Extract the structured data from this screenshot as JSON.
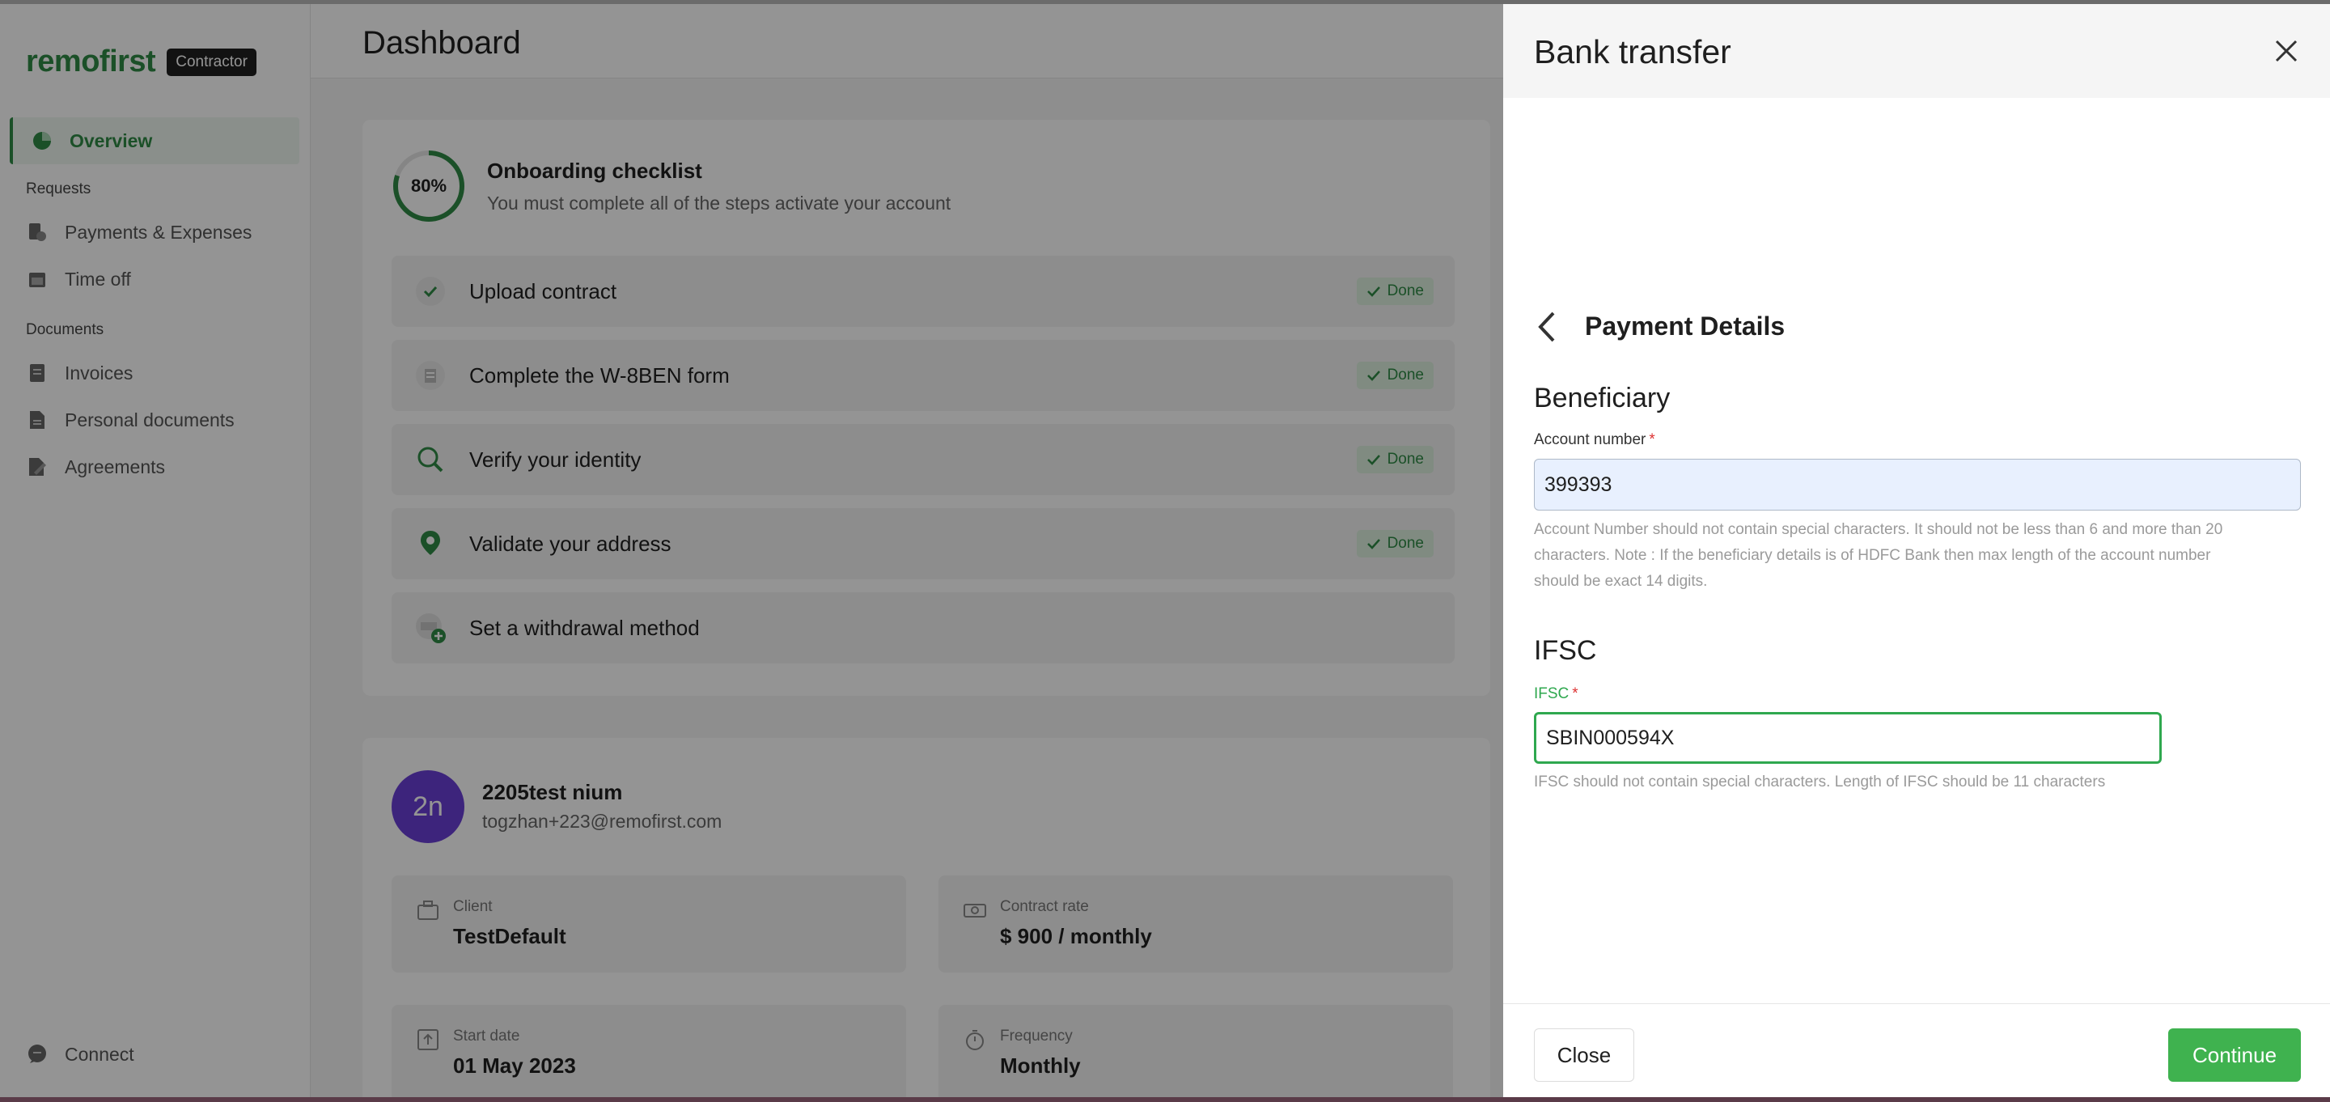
{
  "sidebar": {
    "logo": "remofirst",
    "badge": "Contractor",
    "overview": "Overview",
    "requests_section": "Requests",
    "payments": "Payments & Expenses",
    "timeoff": "Time off",
    "documents_section": "Documents",
    "invoices": "Invoices",
    "personal_docs": "Personal documents",
    "agreements": "Agreements",
    "connect": "Connect"
  },
  "header": {
    "title": "Dashboard"
  },
  "checklist": {
    "progress": "80%",
    "progress_value": 0.8,
    "title": "Onboarding checklist",
    "subtitle": "You must complete all of the steps activate your account",
    "steps": [
      {
        "label": "Upload contract",
        "status": "Done",
        "icon": "check-circle-icon"
      },
      {
        "label": "Complete the W-8BEN form",
        "status": "Done",
        "icon": "form-icon"
      },
      {
        "label": "Verify your identity",
        "status": "Done",
        "icon": "magnifier-icon"
      },
      {
        "label": "Validate your address",
        "status": "Done",
        "icon": "location-pin-icon"
      },
      {
        "label": "Set a withdrawal method",
        "status": "",
        "icon": "withdrawal-icon"
      }
    ]
  },
  "profile": {
    "initials": "2n",
    "name": "2205test nium",
    "email": "togzhan+223@remofirst.com",
    "client_label": "Client",
    "client_value": "TestDefault",
    "rate_label": "Contract rate",
    "rate_value": "$ 900 / monthly",
    "start_label": "Start date",
    "start_value": "01 May 2023",
    "frequency_label": "Frequency",
    "frequency_value": "Monthly"
  },
  "drawer": {
    "title": "Bank transfer",
    "subtitle": "Payment Details",
    "beneficiary_section": "Beneficiary",
    "account_label": "Account number",
    "account_value": "399393",
    "account_hint_1": "Account Number should not contain special characters. It should not be less than 6 and more than 20",
    "account_hint_2": "characters. Note : If the beneficiary details is of HDFC Bank then max length of the account number",
    "account_hint_3": "should be exact 14 digits.",
    "ifsc_section": "IFSC",
    "ifsc_label": "IFSC",
    "ifsc_value": "SBIN000594X",
    "ifsc_hint": "IFSC should not contain special characters. Length of IFSC should be 11 characters",
    "required_mark": "*",
    "close_button": "Close",
    "continue_button": "Continue"
  },
  "colors": {
    "brand_green": "#2f8a45",
    "continue_green": "#3fb24f",
    "avatar_purple": "#6a3fd6",
    "autofill_blue": "#e8f0fe"
  }
}
